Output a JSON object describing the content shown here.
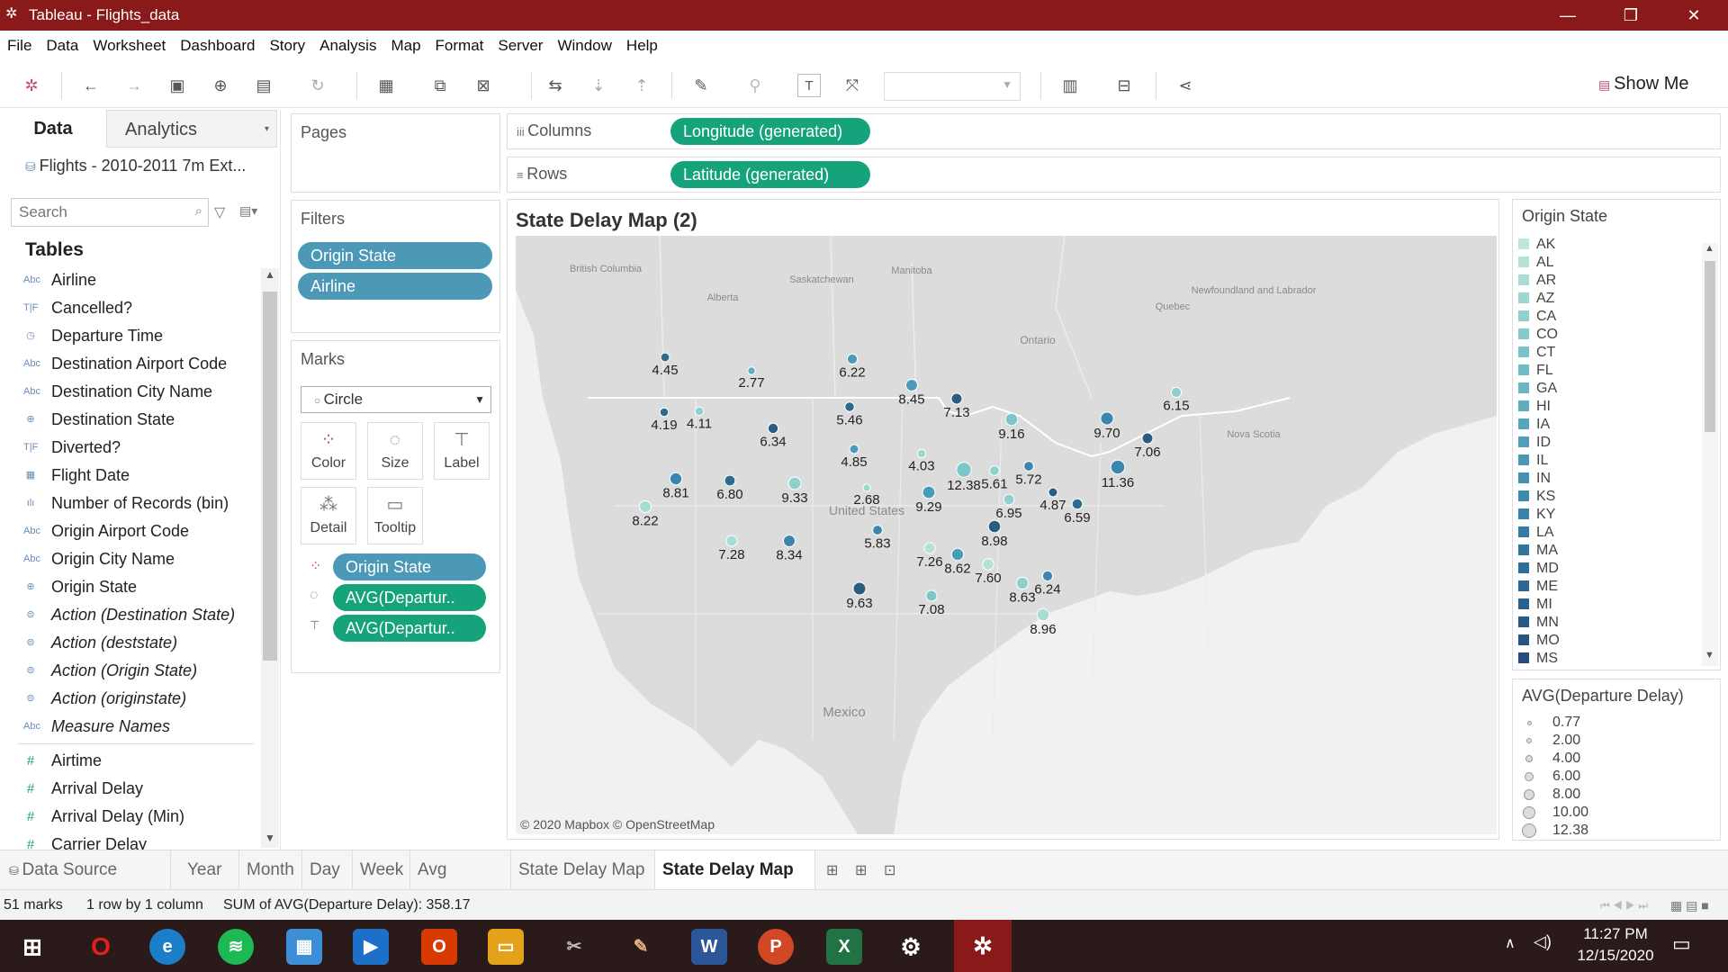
{
  "window": {
    "title": "Tableau - Flights_data"
  },
  "menu": [
    "File",
    "Data",
    "Worksheet",
    "Dashboard",
    "Story",
    "Analysis",
    "Map",
    "Format",
    "Server",
    "Window",
    "Help"
  ],
  "toolbar": {
    "show_me": "Show Me"
  },
  "left_pane": {
    "tab_data": "Data",
    "tab_analytics": "Analytics",
    "datasource": "Flights - 2010-2011 7m Ext...",
    "search_placeholder": "Search",
    "tables_header": "Tables",
    "dimensions": [
      {
        "icon": "Abc",
        "label": "Airline",
        "italic": false
      },
      {
        "icon": "T|F",
        "label": "Cancelled?",
        "italic": false
      },
      {
        "icon": "clock",
        "label": "Departure Time",
        "italic": false
      },
      {
        "icon": "Abc",
        "label": "Destination Airport Code",
        "italic": false
      },
      {
        "icon": "Abc",
        "label": "Destination City Name",
        "italic": false
      },
      {
        "icon": "globe",
        "label": "Destination State",
        "italic": false
      },
      {
        "icon": "T|F",
        "label": "Diverted?",
        "italic": false
      },
      {
        "icon": "calendar",
        "label": "Flight Date",
        "italic": false
      },
      {
        "icon": "bin",
        "label": "Number of Records (bin)",
        "italic": false
      },
      {
        "icon": "Abc",
        "label": "Origin Airport Code",
        "italic": false
      },
      {
        "icon": "Abc",
        "label": "Origin City Name",
        "italic": false
      },
      {
        "icon": "globe",
        "label": "Origin State",
        "italic": false
      },
      {
        "icon": "set",
        "label": "Action (Destination State)",
        "italic": true
      },
      {
        "icon": "set",
        "label": "Action (deststate)",
        "italic": true
      },
      {
        "icon": "set",
        "label": "Action (Origin State)",
        "italic": true
      },
      {
        "icon": "set",
        "label": "Action (originstate)",
        "italic": true
      },
      {
        "icon": "Abc",
        "label": "Measure Names",
        "italic": true
      }
    ],
    "measures": [
      {
        "icon": "#",
        "label": "Airtime"
      },
      {
        "icon": "#",
        "label": "Arrival Delay"
      },
      {
        "icon": "#",
        "label": "Arrival Delay (Min)"
      },
      {
        "icon": "#",
        "label": "Carrier Delay"
      }
    ]
  },
  "shelves": {
    "pages": "Pages",
    "filters": "Filters",
    "filter_pills": [
      "Origin State",
      "Airline"
    ],
    "columns_label": "Columns",
    "rows_label": "Rows",
    "columns_pill": "Longitude (generated)",
    "rows_pill": "Latitude (generated)"
  },
  "marks": {
    "title": "Marks",
    "type": "Circle",
    "buttons": [
      "Color",
      "Size",
      "Label",
      "Detail",
      "Tooltip"
    ],
    "pills": [
      "Origin State",
      "AVG(Departur..",
      "AVG(Departur.."
    ]
  },
  "view": {
    "title": "State Delay Map (2)",
    "attribution": "© 2020 Mapbox © OpenStreetMap",
    "place_labels": [
      "British Columbia",
      "Alberta",
      "Saskatchewan",
      "Manitoba",
      "Ontario",
      "Quebec",
      "Newfoundland and Labrador",
      "Nova Scotia",
      "United States",
      "Mexico"
    ],
    "marks": [
      {
        "v": "4.45",
        "c": "#2c6d8e"
      },
      {
        "v": "2.77",
        "c": "#5fb1c2"
      },
      {
        "v": "6.22",
        "c": "#4a9bb9"
      },
      {
        "v": "8.45",
        "c": "#4a9bb9"
      },
      {
        "v": "6.15",
        "c": "#8fd0cc"
      },
      {
        "v": "4.19",
        "c": "#2c6d8e"
      },
      {
        "v": "4.11",
        "c": "#8fd0cc"
      },
      {
        "v": "5.46",
        "c": "#2c6d8e"
      },
      {
        "v": "7.13",
        "c": "#2c5c80"
      },
      {
        "v": "9.16",
        "c": "#7cc5c8"
      },
      {
        "v": "9.70",
        "c": "#3b86ae"
      },
      {
        "v": "6.34",
        "c": "#2c5c80"
      },
      {
        "v": "4.03",
        "c": "#9dd6cf"
      },
      {
        "v": "4.85",
        "c": "#4a9bb9"
      },
      {
        "v": "7.06",
        "c": "#2c5c80"
      },
      {
        "v": "12.38",
        "c": "#7cc5c8"
      },
      {
        "v": "5.61",
        "c": "#8fd0cc"
      },
      {
        "v": "5.72",
        "c": "#3b86ae"
      },
      {
        "v": "11.36",
        "c": "#3b86ae"
      },
      {
        "v": "8.81",
        "c": "#3b86ae"
      },
      {
        "v": "6.80",
        "c": "#2c6d8e"
      },
      {
        "v": "9.33",
        "c": "#8fd0cc"
      },
      {
        "v": "2.68",
        "c": "#9dd6cf"
      },
      {
        "v": "9.29",
        "c": "#4a9bb9"
      },
      {
        "v": "4.87",
        "c": "#2c5c80"
      },
      {
        "v": "6.95",
        "c": "#8fd0cc"
      },
      {
        "v": "6.59",
        "c": "#2c6d8e"
      },
      {
        "v": "8.22",
        "c": "#a8ddd4"
      },
      {
        "v": "8.98",
        "c": "#2c5c80"
      },
      {
        "v": "5.83",
        "c": "#3b86ae"
      },
      {
        "v": "7.28",
        "c": "#a8ddd4"
      },
      {
        "v": "8.34",
        "c": "#3b86ae"
      },
      {
        "v": "7.26",
        "c": "#b5e2d6"
      },
      {
        "v": "8.62",
        "c": "#4a9bb9"
      },
      {
        "v": "7.60",
        "c": "#b5e2d6"
      },
      {
        "v": "6.24",
        "c": "#3b86ae"
      },
      {
        "v": "8.63",
        "c": "#8fd0cc"
      },
      {
        "v": "9.63",
        "c": "#2c5c80"
      },
      {
        "v": "7.08",
        "c": "#7cc5c8"
      },
      {
        "v": "8.96",
        "c": "#a8ddd4"
      }
    ]
  },
  "legend_color": {
    "title": "Origin State",
    "items": [
      {
        "label": "AK",
        "color": "#bfe6da"
      },
      {
        "label": "AL",
        "color": "#b4e1d8"
      },
      {
        "label": "AR",
        "color": "#a8dcd5"
      },
      {
        "label": "AZ",
        "color": "#9dd6d2"
      },
      {
        "label": "CA",
        "color": "#91d0cf"
      },
      {
        "label": "CO",
        "color": "#86cacc"
      },
      {
        "label": "CT",
        "color": "#7cc3c9"
      },
      {
        "label": "FL",
        "color": "#72bcc6"
      },
      {
        "label": "GA",
        "color": "#68b5c3"
      },
      {
        "label": "HI",
        "color": "#5faec0"
      },
      {
        "label": "IA",
        "color": "#56a7bd"
      },
      {
        "label": "ID",
        "color": "#4ea0ba"
      },
      {
        "label": "IL",
        "color": "#4799b6"
      },
      {
        "label": "IN",
        "color": "#4192b2"
      },
      {
        "label": "KS",
        "color": "#3b8bae"
      },
      {
        "label": "KY",
        "color": "#3684aa"
      },
      {
        "label": "LA",
        "color": "#327da5"
      },
      {
        "label": "MA",
        "color": "#2e76a0"
      },
      {
        "label": "MD",
        "color": "#2b6f9b"
      },
      {
        "label": "ME",
        "color": "#296896"
      },
      {
        "label": "MI",
        "color": "#276190"
      },
      {
        "label": "MN",
        "color": "#255a8a"
      },
      {
        "label": "MO",
        "color": "#245384"
      },
      {
        "label": "MS",
        "color": "#234d7e"
      }
    ]
  },
  "legend_size": {
    "title": "AVG(Departure Delay)",
    "items": [
      "0.77",
      "2.00",
      "4.00",
      "6.00",
      "8.00",
      "10.00",
      "12.38"
    ]
  },
  "sheet_tabs": {
    "datasource": "Data Source",
    "tabs": [
      "Year",
      "Month",
      "Day",
      "Week",
      "Avg Delays",
      "State Delay Map",
      "State Delay Map (2)"
    ],
    "active": "State Delay Map (2)"
  },
  "status": {
    "marks": "51 marks",
    "dims": "1 row by 1 column",
    "sum": "SUM of AVG(Departure Delay): 358.17"
  },
  "taskbar": {
    "time": "11:27 PM",
    "date": "12/15/2020"
  }
}
